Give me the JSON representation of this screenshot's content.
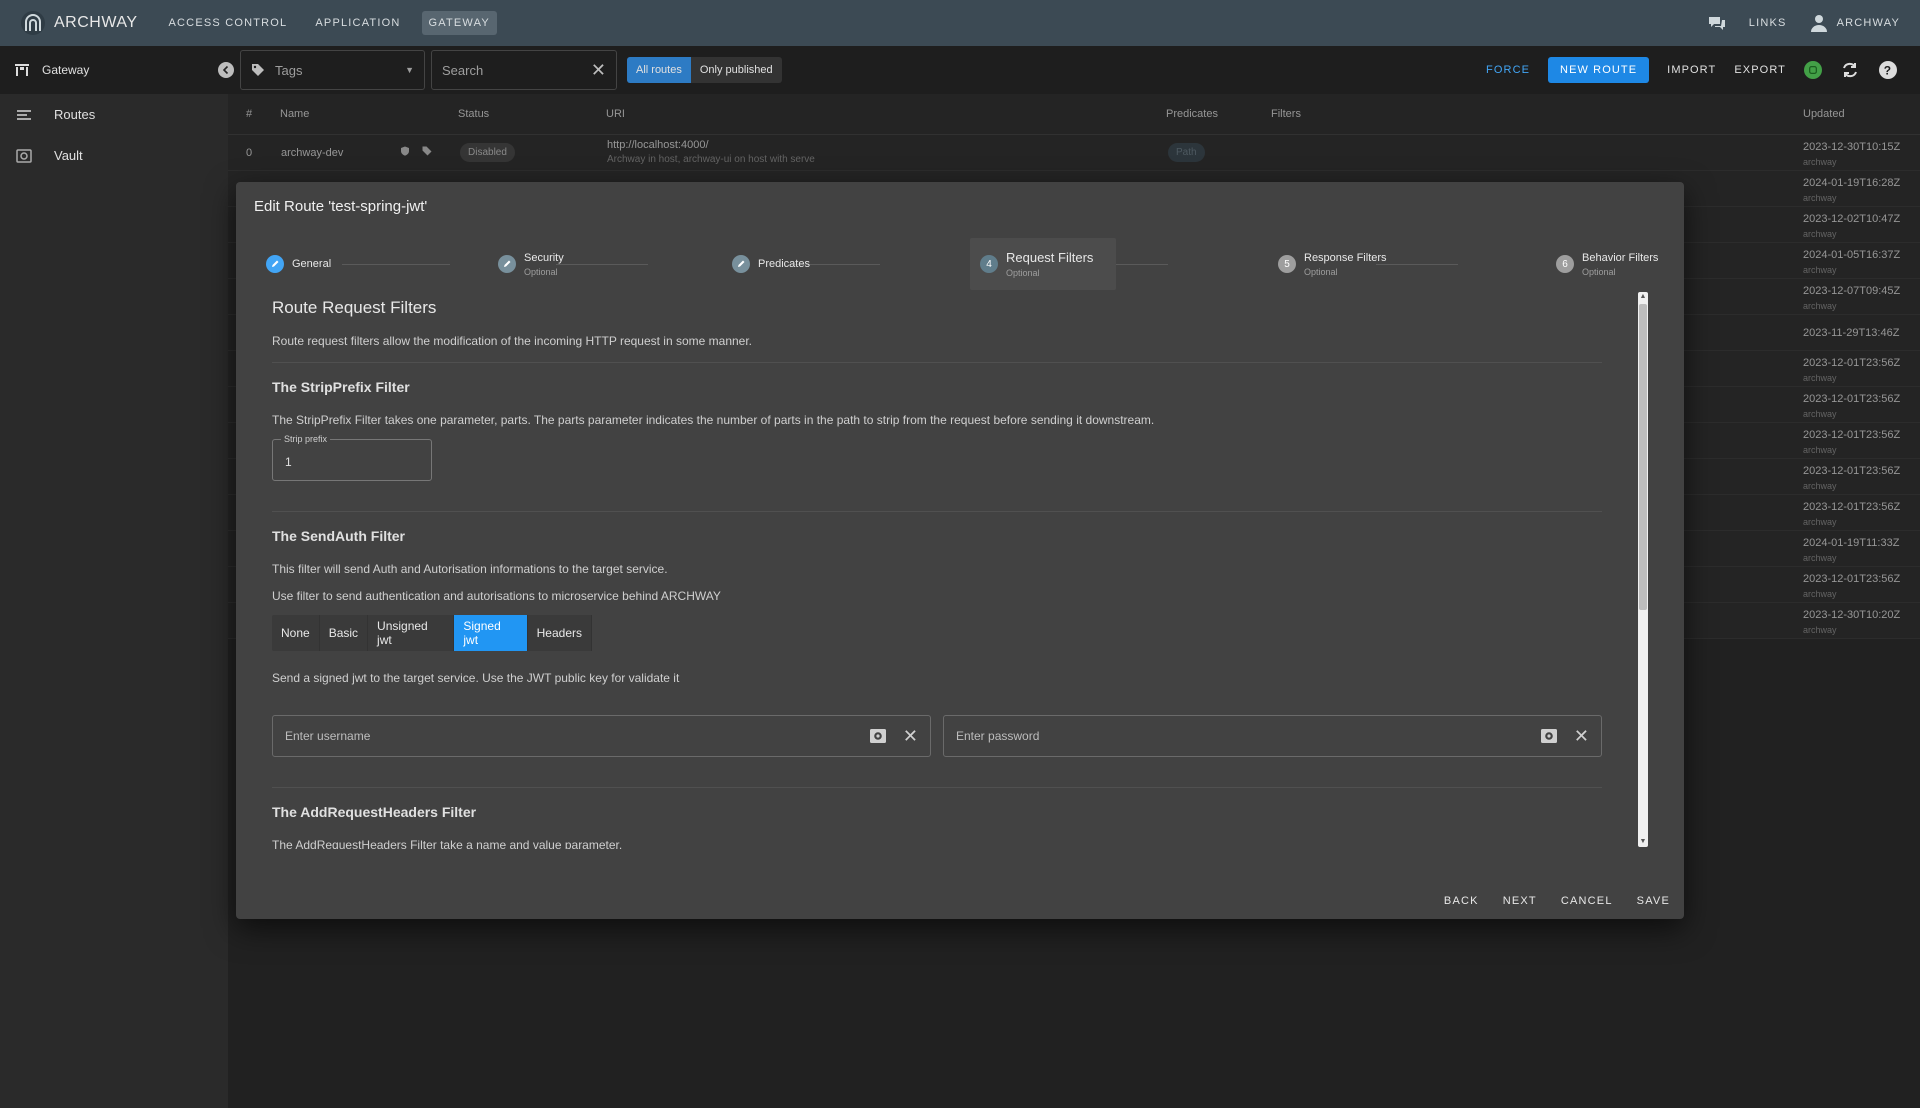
{
  "app": {
    "brand": "ARCHWAY",
    "nav": [
      {
        "label": "ACCESS CONTROL"
      },
      {
        "label": "APPLICATION"
      },
      {
        "label": "GATEWAY"
      }
    ],
    "links_label": "LINKS",
    "user_label": "ARCHWAY"
  },
  "toolbar": {
    "section_title": "Gateway",
    "tags_placeholder": "Tags",
    "search_placeholder": "Search",
    "toggle_all": "All routes",
    "toggle_published": "Only published",
    "force": "FORCE",
    "new_route": "NEW ROUTE",
    "import": "IMPORT",
    "export": "EXPORT",
    "colors": {
      "accent": "#1e88e5",
      "status_ok": "#43a047"
    }
  },
  "sidebar": {
    "items": [
      {
        "label": "Routes"
      },
      {
        "label": "Vault"
      }
    ]
  },
  "table": {
    "headers": {
      "index": "#",
      "name": "Name",
      "status": "Status",
      "uri": "URI",
      "predicates": "Predicates",
      "filters": "Filters",
      "updated": "Updated"
    },
    "first_row": {
      "index": "0",
      "name": "archway-dev",
      "status": "Disabled",
      "uri": "http://localhost:4000/",
      "uri_desc": "Archway in host, archway-ui on host with serve",
      "predicate": "Path"
    },
    "rows": [
      {
        "date": "2023-12-30T10:15Z",
        "user": "archway"
      },
      {
        "date": "2024-01-19T16:28Z",
        "user": "archway"
      },
      {
        "date": "2023-12-02T10:47Z",
        "user": "archway"
      },
      {
        "date": "2024-01-05T16:37Z",
        "user": "archway"
      },
      {
        "date": "2023-12-07T09:45Z",
        "user": "archway"
      },
      {
        "date": "2023-11-29T13:46Z",
        "user": ""
      },
      {
        "date": "2023-12-01T23:56Z",
        "user": "archway"
      },
      {
        "date": "2023-12-01T23:56Z",
        "user": "archway"
      },
      {
        "date": "2023-12-01T23:56Z",
        "user": "archway"
      },
      {
        "date": "2023-12-01T23:56Z",
        "user": "archway"
      },
      {
        "date": "2023-12-01T23:56Z",
        "user": "archway"
      },
      {
        "date": "2024-01-19T11:33Z",
        "user": "archway"
      },
      {
        "date": "2023-12-01T23:56Z",
        "user": "archway"
      },
      {
        "date": "2023-12-30T10:20Z",
        "user": "archway"
      }
    ]
  },
  "dialog": {
    "title": "Edit Route 'test-spring-jwt'",
    "steps": [
      {
        "num": "1",
        "label": "General",
        "optional": ""
      },
      {
        "num": "2",
        "label": "Security",
        "optional": "Optional"
      },
      {
        "num": "3",
        "label": "Predicates",
        "optional": ""
      },
      {
        "num": "4",
        "label": "Request Filters",
        "optional": "Optional"
      },
      {
        "num": "5",
        "label": "Response Filters",
        "optional": "Optional"
      },
      {
        "num": "6",
        "label": "Behavior Filters",
        "optional": "Optional"
      }
    ],
    "heading": "Route Request Filters",
    "intro": "Route request filters allow the modification of the incoming HTTP request in some manner.",
    "strip": {
      "title": "The StripPrefix Filter",
      "desc": "The StripPrefix Filter takes one parameter, parts. The parts parameter indicates the number of parts in the path to strip from the request before sending it downstream.",
      "field_label": "Strip prefix",
      "value": "1"
    },
    "sendauth": {
      "title": "The SendAuth Filter",
      "desc1": "This filter will send Auth and Autorisation informations to the target service.",
      "desc2": "Use filter to send authentication and autorisations to microservice behind ARCHWAY",
      "options": [
        "None",
        "Basic",
        "Unsigned jwt",
        "Signed jwt",
        "Headers"
      ],
      "selected": "Signed jwt",
      "mode_desc": "Send a signed jwt to the target service. Use the JWT public key for validate it",
      "username_placeholder": "Enter username",
      "password_placeholder": "Enter password"
    },
    "addheaders": {
      "title": "The AddRequestHeaders Filter",
      "desc": "The AddRequestHeaders Filter take a name and value parameter."
    },
    "actions": {
      "back": "BACK",
      "next": "NEXT",
      "cancel": "CANCEL",
      "save": "SAVE"
    }
  }
}
